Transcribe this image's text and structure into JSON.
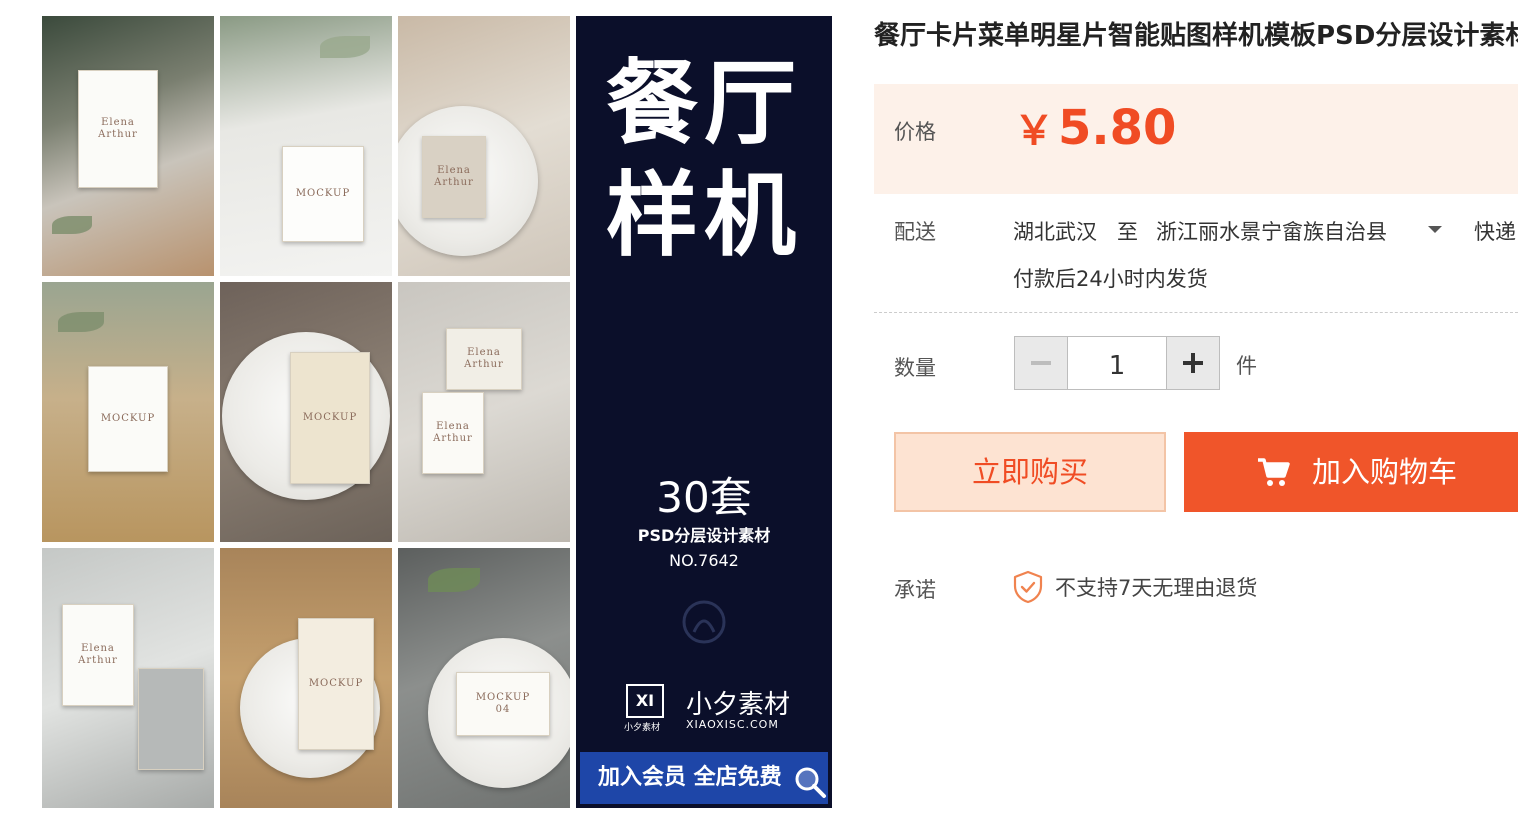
{
  "banner": {
    "line1": "餐厅",
    "line2": "样机",
    "sets": "30套",
    "psd": "PSD分层设计素材",
    "no": "NO.7642",
    "brand_mark": "XI",
    "brand_sub": "小夕素材",
    "brand_name": "小夕素材",
    "brand_url": "XIAOXISC.COM",
    "member": "加入会员 全店免费"
  },
  "tiles": [
    {
      "card_text": "Elena\nArthur"
    },
    {
      "card_text": "MOCKUP"
    },
    {
      "card_text": "Elena\nArthur"
    },
    {
      "card_text": "MOCKUP"
    },
    {
      "card_text": "MOCKUP"
    },
    {
      "card_text": "Elena\nArthur"
    },
    {
      "card_text": "Elena\nArthur"
    },
    {
      "card_text": "MOCKUP"
    },
    {
      "card_text": "MOCKUP\n04"
    }
  ],
  "product": {
    "title": "餐厅卡片菜单明星片智能贴图样机模板PSD分层设计素材"
  },
  "price": {
    "label": "价格",
    "currency": "￥",
    "value": "5.80"
  },
  "shipping": {
    "label": "配送",
    "from": "湖北武汉",
    "to_word": "至",
    "to": "浙江丽水景宁畲族自治县",
    "method": "快递",
    "dispatch": "付款后24小时内发货"
  },
  "quantity": {
    "label": "数量",
    "value": "1",
    "unit": "件"
  },
  "actions": {
    "buy_now": "立即购买",
    "add_to_cart": "加入购物车"
  },
  "promise": {
    "label": "承诺",
    "text": "不支持7天无理由退货"
  },
  "colors": {
    "accent": "#f04c24",
    "price_bg": "#fdf1e9",
    "banner_bg": "#0b0f2a",
    "member_bar": "#1e46a8"
  }
}
